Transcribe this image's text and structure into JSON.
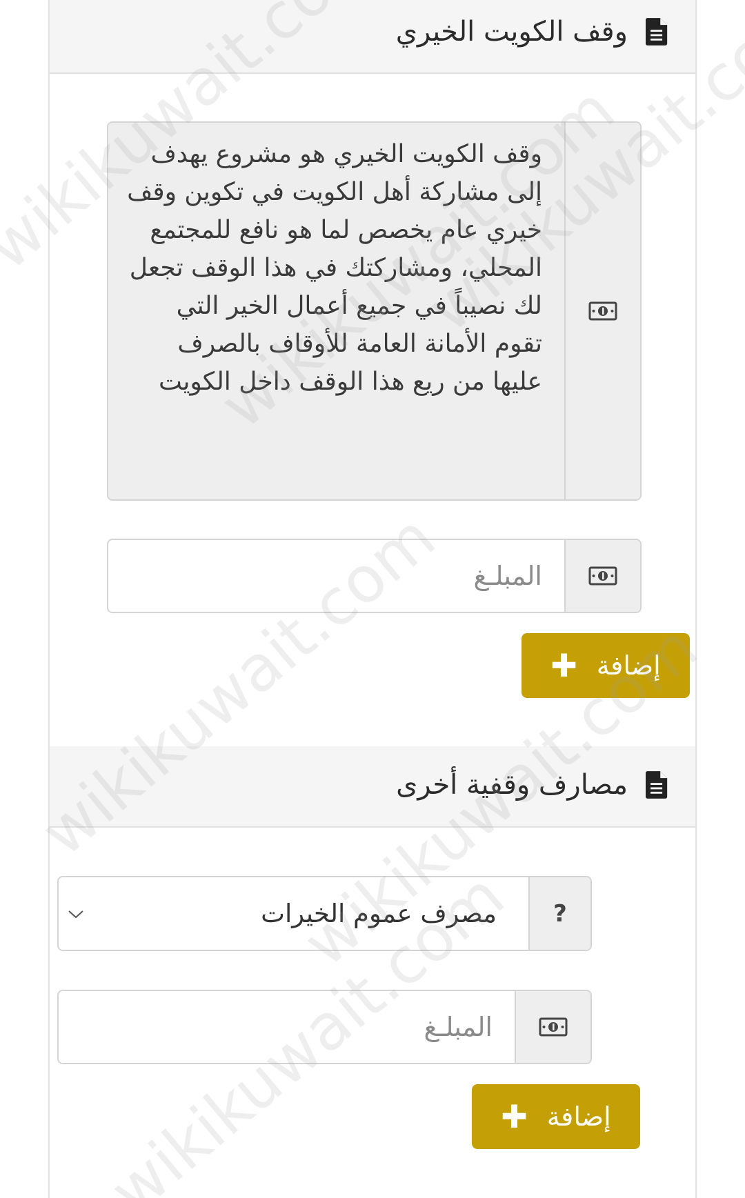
{
  "section_1": {
    "title": "وقف الكويت الخيري",
    "description": "وقف الكويت الخيري هو مشروع يهدف إلى مشاركة أهل الكويت في تكوين وقف خيري عام يخصص لما هو نافع للمجتمع المحلي، ومشاركتك في هذا الوقف تجعل لك نصيباً في جميع أعمال الخير التي تقوم الأمانة العامة للأوقاف بالصرف عليها من ريع هذا الوقف داخل الكويت",
    "amount_placeholder": "المبلـغ",
    "add_label": "إضافة"
  },
  "section_2": {
    "title": "مصارف وقفية أخرى",
    "help_label": "?",
    "selected_option": "مصرف عموم الخيرات",
    "amount_placeholder": "المبلـغ",
    "add_label": "إضافة"
  },
  "icons": {
    "header": "document-icon",
    "addon": "money-icon",
    "button": "plus-icon",
    "select": "chevron-down-icon"
  },
  "colors": {
    "accent": "#c4a006",
    "header_bg": "#f5f5f5",
    "addon_bg": "#eeeeee"
  },
  "watermark": "wikikuwait.com"
}
